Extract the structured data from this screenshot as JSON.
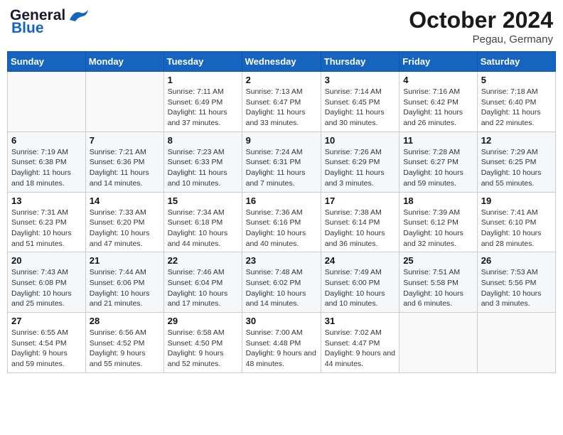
{
  "header": {
    "logo_general": "General",
    "logo_blue": "Blue",
    "month_title": "October 2024",
    "location": "Pegau, Germany"
  },
  "weekdays": [
    "Sunday",
    "Monday",
    "Tuesday",
    "Wednesday",
    "Thursday",
    "Friday",
    "Saturday"
  ],
  "weeks": [
    [
      {
        "day": "",
        "detail": ""
      },
      {
        "day": "",
        "detail": ""
      },
      {
        "day": "1",
        "detail": "Sunrise: 7:11 AM\nSunset: 6:49 PM\nDaylight: 11 hours and 37 minutes."
      },
      {
        "day": "2",
        "detail": "Sunrise: 7:13 AM\nSunset: 6:47 PM\nDaylight: 11 hours and 33 minutes."
      },
      {
        "day": "3",
        "detail": "Sunrise: 7:14 AM\nSunset: 6:45 PM\nDaylight: 11 hours and 30 minutes."
      },
      {
        "day": "4",
        "detail": "Sunrise: 7:16 AM\nSunset: 6:42 PM\nDaylight: 11 hours and 26 minutes."
      },
      {
        "day": "5",
        "detail": "Sunrise: 7:18 AM\nSunset: 6:40 PM\nDaylight: 11 hours and 22 minutes."
      }
    ],
    [
      {
        "day": "6",
        "detail": "Sunrise: 7:19 AM\nSunset: 6:38 PM\nDaylight: 11 hours and 18 minutes."
      },
      {
        "day": "7",
        "detail": "Sunrise: 7:21 AM\nSunset: 6:36 PM\nDaylight: 11 hours and 14 minutes."
      },
      {
        "day": "8",
        "detail": "Sunrise: 7:23 AM\nSunset: 6:33 PM\nDaylight: 11 hours and 10 minutes."
      },
      {
        "day": "9",
        "detail": "Sunrise: 7:24 AM\nSunset: 6:31 PM\nDaylight: 11 hours and 7 minutes."
      },
      {
        "day": "10",
        "detail": "Sunrise: 7:26 AM\nSunset: 6:29 PM\nDaylight: 11 hours and 3 minutes."
      },
      {
        "day": "11",
        "detail": "Sunrise: 7:28 AM\nSunset: 6:27 PM\nDaylight: 10 hours and 59 minutes."
      },
      {
        "day": "12",
        "detail": "Sunrise: 7:29 AM\nSunset: 6:25 PM\nDaylight: 10 hours and 55 minutes."
      }
    ],
    [
      {
        "day": "13",
        "detail": "Sunrise: 7:31 AM\nSunset: 6:23 PM\nDaylight: 10 hours and 51 minutes."
      },
      {
        "day": "14",
        "detail": "Sunrise: 7:33 AM\nSunset: 6:20 PM\nDaylight: 10 hours and 47 minutes."
      },
      {
        "day": "15",
        "detail": "Sunrise: 7:34 AM\nSunset: 6:18 PM\nDaylight: 10 hours and 44 minutes."
      },
      {
        "day": "16",
        "detail": "Sunrise: 7:36 AM\nSunset: 6:16 PM\nDaylight: 10 hours and 40 minutes."
      },
      {
        "day": "17",
        "detail": "Sunrise: 7:38 AM\nSunset: 6:14 PM\nDaylight: 10 hours and 36 minutes."
      },
      {
        "day": "18",
        "detail": "Sunrise: 7:39 AM\nSunset: 6:12 PM\nDaylight: 10 hours and 32 minutes."
      },
      {
        "day": "19",
        "detail": "Sunrise: 7:41 AM\nSunset: 6:10 PM\nDaylight: 10 hours and 28 minutes."
      }
    ],
    [
      {
        "day": "20",
        "detail": "Sunrise: 7:43 AM\nSunset: 6:08 PM\nDaylight: 10 hours and 25 minutes."
      },
      {
        "day": "21",
        "detail": "Sunrise: 7:44 AM\nSunset: 6:06 PM\nDaylight: 10 hours and 21 minutes."
      },
      {
        "day": "22",
        "detail": "Sunrise: 7:46 AM\nSunset: 6:04 PM\nDaylight: 10 hours and 17 minutes."
      },
      {
        "day": "23",
        "detail": "Sunrise: 7:48 AM\nSunset: 6:02 PM\nDaylight: 10 hours and 14 minutes."
      },
      {
        "day": "24",
        "detail": "Sunrise: 7:49 AM\nSunset: 6:00 PM\nDaylight: 10 hours and 10 minutes."
      },
      {
        "day": "25",
        "detail": "Sunrise: 7:51 AM\nSunset: 5:58 PM\nDaylight: 10 hours and 6 minutes."
      },
      {
        "day": "26",
        "detail": "Sunrise: 7:53 AM\nSunset: 5:56 PM\nDaylight: 10 hours and 3 minutes."
      }
    ],
    [
      {
        "day": "27",
        "detail": "Sunrise: 6:55 AM\nSunset: 4:54 PM\nDaylight: 9 hours and 59 minutes."
      },
      {
        "day": "28",
        "detail": "Sunrise: 6:56 AM\nSunset: 4:52 PM\nDaylight: 9 hours and 55 minutes."
      },
      {
        "day": "29",
        "detail": "Sunrise: 6:58 AM\nSunset: 4:50 PM\nDaylight: 9 hours and 52 minutes."
      },
      {
        "day": "30",
        "detail": "Sunrise: 7:00 AM\nSunset: 4:48 PM\nDaylight: 9 hours and 48 minutes."
      },
      {
        "day": "31",
        "detail": "Sunrise: 7:02 AM\nSunset: 4:47 PM\nDaylight: 9 hours and 44 minutes."
      },
      {
        "day": "",
        "detail": ""
      },
      {
        "day": "",
        "detail": ""
      }
    ]
  ]
}
